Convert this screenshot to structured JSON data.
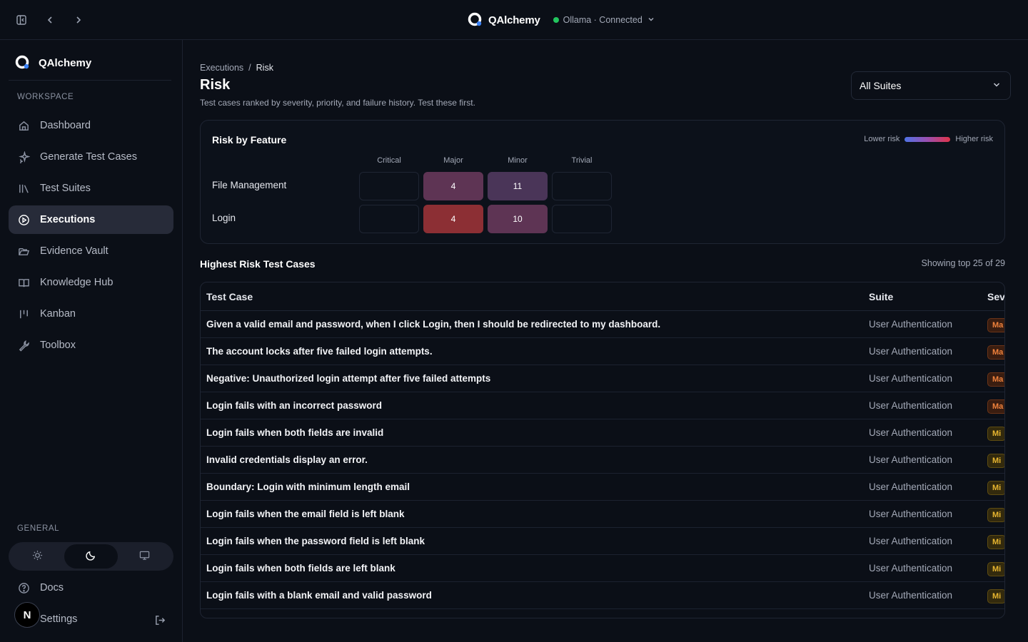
{
  "app": {
    "name": "QAlchemy",
    "connection": "Ollama · Connected",
    "connection_color": "#22c55e"
  },
  "sidebar": {
    "brand": "QAlchemy",
    "workspace_label": "WORKSPACE",
    "general_label": "GENERAL",
    "items": [
      {
        "label": "Dashboard",
        "icon": "home-icon"
      },
      {
        "label": "Generate Test Cases",
        "icon": "sparkles-icon"
      },
      {
        "label": "Test Suites",
        "icon": "library-icon"
      },
      {
        "label": "Executions",
        "icon": "play-circle-icon",
        "active": true
      },
      {
        "label": "Evidence Vault",
        "icon": "folder-open-icon"
      },
      {
        "label": "Knowledge Hub",
        "icon": "book-open-icon"
      },
      {
        "label": "Kanban",
        "icon": "kanban-icon"
      },
      {
        "label": "Toolbox",
        "icon": "wrench-icon"
      }
    ],
    "general_items": [
      {
        "label": "Docs",
        "icon": "help-circle-icon"
      },
      {
        "label": "Settings",
        "icon": "settings-icon"
      }
    ],
    "avatar_initial": "N",
    "theme_active": "dark"
  },
  "page": {
    "breadcrumb_parent": "Executions",
    "breadcrumb_sep": "/",
    "breadcrumb_current": "Risk",
    "title": "Risk",
    "subtitle": "Test cases ranked by severity, priority, and failure history. Test these first.",
    "suite_filter": "All Suites"
  },
  "risk_card": {
    "title": "Risk by Feature",
    "legend_low": "Lower risk",
    "legend_high": "Higher risk",
    "columns": [
      "Critical",
      "Major",
      "Minor",
      "Trivial"
    ],
    "rows": [
      {
        "feature": "File Management",
        "values": [
          "",
          "4",
          "11",
          ""
        ],
        "colors": [
          "",
          "#5e3454",
          "#4a3558",
          ""
        ]
      },
      {
        "feature": "Login",
        "values": [
          "",
          "4",
          "10",
          ""
        ],
        "colors": [
          "",
          "#8c2f34",
          "#5e3454",
          ""
        ]
      }
    ]
  },
  "table": {
    "title": "Highest Risk Test Cases",
    "showing": "Showing top 25 of 29",
    "headers": {
      "case": "Test Case",
      "suite": "Suite",
      "severity": "Sev"
    },
    "rows": [
      {
        "case": "Given a valid email and password, when I click Login, then I should be redirected to my dashboard.",
        "suite": "User Authentication",
        "sev": "Ma",
        "sev_class": "major"
      },
      {
        "case": "The account locks after five failed login attempts.",
        "suite": "User Authentication",
        "sev": "Ma",
        "sev_class": "major"
      },
      {
        "case": "Negative: Unauthorized login attempt after five failed attempts",
        "suite": "User Authentication",
        "sev": "Ma",
        "sev_class": "major"
      },
      {
        "case": "Login fails with an incorrect password",
        "suite": "User Authentication",
        "sev": "Ma",
        "sev_class": "major"
      },
      {
        "case": "Login fails when both fields are invalid",
        "suite": "User Authentication",
        "sev": "Mi",
        "sev_class": "minor"
      },
      {
        "case": "Invalid credentials display an error.",
        "suite": "User Authentication",
        "sev": "Mi",
        "sev_class": "minor"
      },
      {
        "case": "Boundary: Login with minimum length email",
        "suite": "User Authentication",
        "sev": "Mi",
        "sev_class": "minor"
      },
      {
        "case": "Login fails when the email field is left blank",
        "suite": "User Authentication",
        "sev": "Mi",
        "sev_class": "minor"
      },
      {
        "case": "Login fails when the password field is left blank",
        "suite": "User Authentication",
        "sev": "Mi",
        "sev_class": "minor"
      },
      {
        "case": "Login fails when both fields are left blank",
        "suite": "User Authentication",
        "sev": "Mi",
        "sev_class": "minor"
      },
      {
        "case": "Login fails with a blank email and valid password",
        "suite": "User Authentication",
        "sev": "Mi",
        "sev_class": "minor"
      }
    ]
  }
}
